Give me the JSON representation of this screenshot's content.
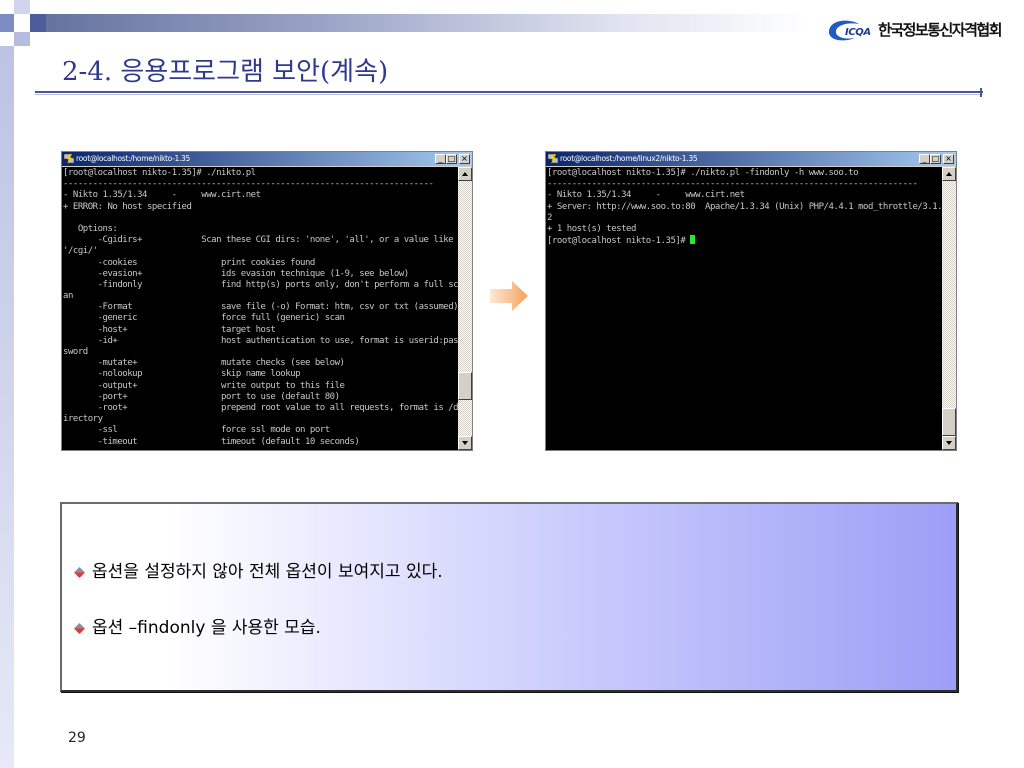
{
  "slide": {
    "title": "2-4. 응용프로그램 보안(계속)",
    "page_number": "29"
  },
  "logo": {
    "icon": "icqa-swoosh-icon",
    "abbr": "ICQA",
    "org_name": "한국정보통신자격협회"
  },
  "window_buttons": {
    "minimize": "_",
    "maximize": "□",
    "close": "×"
  },
  "terminals": [
    {
      "title": "root@localhost:/home/nikto-1.35",
      "icon": "putty-icon",
      "scroll_position": 0.84,
      "lines": [
        "[root@localhost nikto-1.35]# ./nikto.pl",
        "---------------------------------------------------------------------------",
        "- Nikto 1.35/1.34     -     www.cirt.net",
        "+ ERROR: No host specified",
        "",
        "   Options:",
        "       -Cgidirs+            Scan these CGI dirs: 'none', 'all', or a value like",
        "'/cgi/'",
        "       -cookies                 print cookies found",
        "       -evasion+                ids evasion technique (1-9, see below)",
        "       -findonly                find http(s) ports only, don't perform a full sc",
        "an",
        "       -Format                  save file (-o) Format: htm, csv or txt (assumed)",
        "       -generic                 force full (generic) scan",
        "       -host+                   target host",
        "       -id+                     host authentication to use, format is userid:pas",
        "sword",
        "       -mutate+                 mutate checks (see below)",
        "       -nolookup                skip name lookup",
        "       -output+                 write output to this file",
        "       -port+                   port to use (default 80)",
        "       -root+                   prepend root value to all requests, format is /d",
        "irectory",
        "       -ssl                     force ssl mode on port",
        "       -timeout                 timeout (default 10 seconds)"
      ]
    },
    {
      "title": "root@localhost:/home/linux2/nikto-1.35",
      "icon": "putty-icon",
      "scroll_position": 1.0,
      "lines": [
        "[root@localhost nikto-1.35]# ./nikto.pl -findonly -h www.soo.to",
        "---------------------------------------------------------------------------",
        "- Nikto 1.35/1.34     -     www.cirt.net",
        "+ Server: http://www.soo.to:80  Apache/1.3.34 (Unix) PHP/4.4.1 mod_throttle/3.1.",
        "2",
        "+ 1 host(s) tested"
      ],
      "prompt": "[root@localhost nikto-1.35]# "
    }
  ],
  "transition_icon": "arrow-right-icon",
  "notes": {
    "bullet_icon": "diamond-bullet-icon",
    "items": [
      "옵션을 설정하지 않아 전체 옵션이 보여지고 있다.",
      "옵션 –findonly 을 사용한 모습."
    ]
  },
  "colors": {
    "title": "#2f3a8c",
    "terminal_text": "#c8c8c8",
    "cursor": "#2ee62e",
    "titlebar_start": "#0a246a",
    "titlebar_end": "#a6caf0",
    "notes_gradient_end": "#9d9ef6",
    "arrow": "#f6a05c"
  }
}
